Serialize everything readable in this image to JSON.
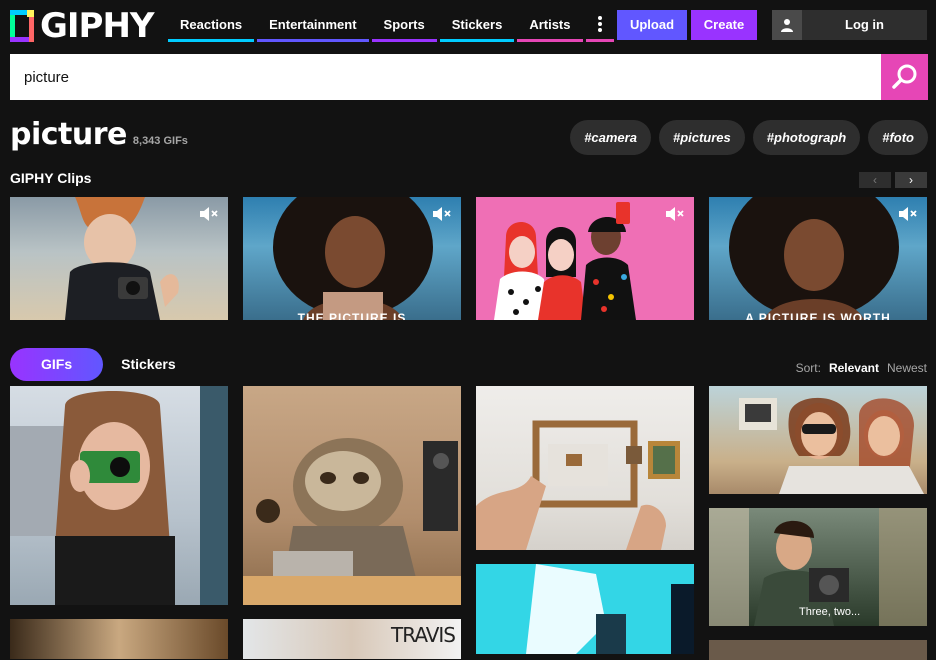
{
  "logo": {
    "text": "GIPHY"
  },
  "nav": {
    "items": [
      {
        "label": "Reactions",
        "color": "#00ccff"
      },
      {
        "label": "Entertainment",
        "color": "#6157ff"
      },
      {
        "label": "Sports",
        "color": "#9933ff"
      },
      {
        "label": "Stickers",
        "color": "#00ccff"
      },
      {
        "label": "Artists",
        "color": "#e646b6"
      }
    ],
    "more_color": "#e646b6"
  },
  "header": {
    "upload": "Upload",
    "create": "Create",
    "login": "Log in"
  },
  "search": {
    "value": "picture"
  },
  "results": {
    "title": "picture",
    "count": "8,343 GIFs"
  },
  "tags": [
    "#camera",
    "#pictures",
    "#photograph",
    "#foto"
  ],
  "clips": {
    "title": "GIPHY Clips",
    "items": [
      {
        "caption": ""
      },
      {
        "caption": "THE PICTURE IS"
      },
      {
        "caption": ""
      },
      {
        "caption": "A PICTURE IS WORTH"
      }
    ]
  },
  "tabs": {
    "gifs": "GIFs",
    "stickers": "Stickers"
  },
  "sort": {
    "label": "Sort:",
    "relevant": "Relevant",
    "newest": "Newest"
  },
  "grid": {
    "items": [
      {
        "caption": ""
      },
      {
        "caption": ""
      },
      {
        "caption": ""
      },
      {
        "caption": ""
      },
      {
        "caption": "Three, two..."
      },
      {
        "caption": "TRAVIS"
      }
    ]
  },
  "colors": {
    "upload": "#6157ff",
    "create": "#9933ff",
    "search_button": "#e646b6"
  }
}
